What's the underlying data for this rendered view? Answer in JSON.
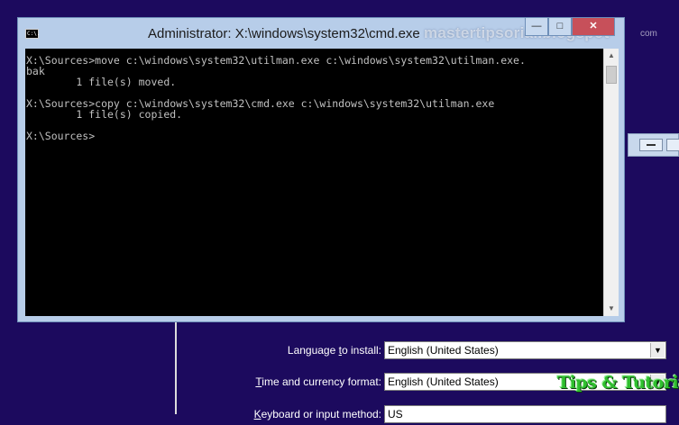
{
  "cmd_window": {
    "title": "Administrator: X:\\windows\\system32\\cmd.exe",
    "icon_text": "C:\\.",
    "console_lines": [
      "X:\\Sources>move c:\\windows\\system32\\utilman.exe c:\\windows\\system32\\utilman.exe.",
      "bak",
      "        1 file(s) moved.",
      "",
      "X:\\Sources>copy c:\\windows\\system32\\cmd.exe c:\\windows\\system32\\utilman.exe",
      "        1 file(s) copied.",
      "",
      "X:\\Sources>"
    ],
    "controls": {
      "minimize": "—",
      "maximize": "□",
      "close": "✕"
    }
  },
  "watermark": {
    "text": "mastertipsorial.blogspot",
    "small": "com"
  },
  "setup": {
    "language_label_pre": "Language ",
    "language_label_u": "t",
    "language_label_post": "o install:",
    "language_value": "English (United States)",
    "time_label_pre": "",
    "time_label_u": "T",
    "time_label_post": "ime and currency format:",
    "time_value": "English (United States)",
    "keyboard_label_pre": "",
    "keyboard_label_u": "K",
    "keyboard_label_post": "eyboard or input method:",
    "keyboard_value": "US",
    "arrow": "▼"
  },
  "logo": {
    "text": "Tips & Tutorial"
  },
  "colors": {
    "desktop_bg": "#1c0a5e",
    "console_bg": "#000000",
    "console_fg": "#c0c0c0",
    "window_frame": "#b7cde9",
    "close_button": "#c7505a",
    "logo_green": "#2fbf2f"
  }
}
